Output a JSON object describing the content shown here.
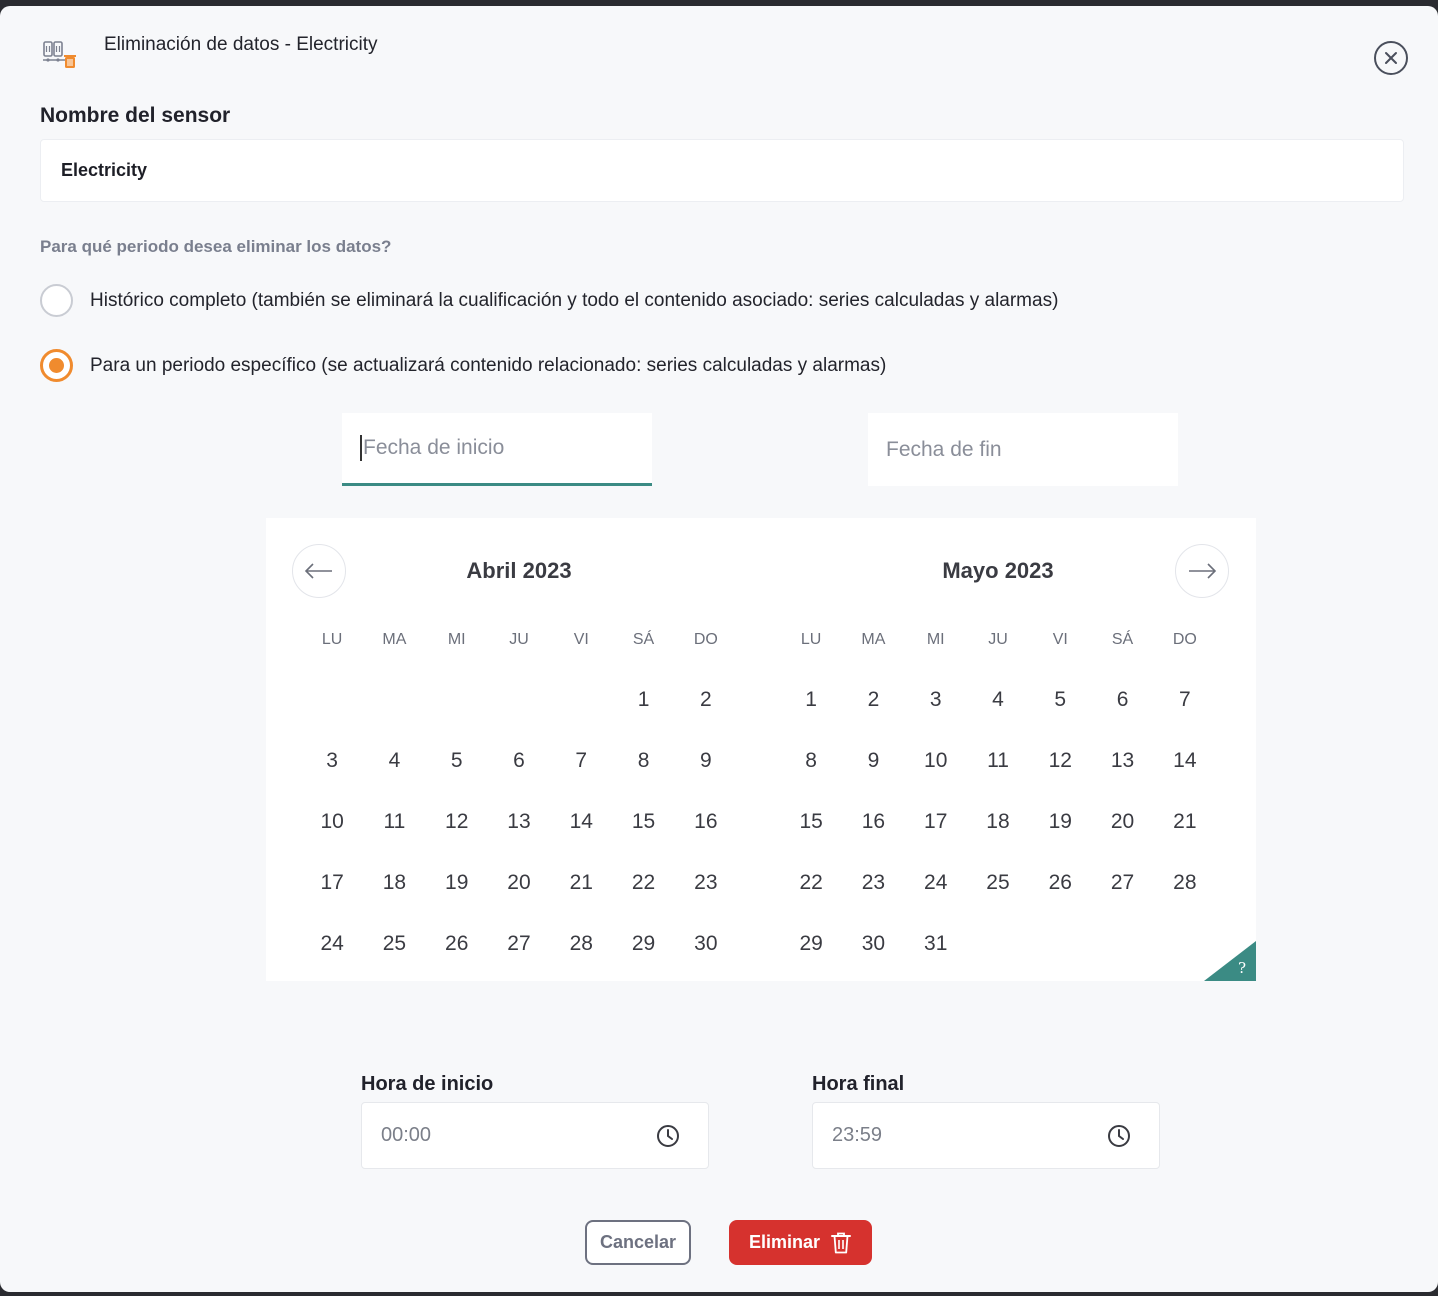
{
  "header": {
    "title": "Eliminación de datos - Electricity",
    "icon": "sensor-delete-icon",
    "close_icon": "close-icon"
  },
  "sensor": {
    "label": "Nombre del sensor",
    "value": "Electricity"
  },
  "period": {
    "question": "Para qué periodo desea eliminar los datos?",
    "options": [
      {
        "label": "Histórico completo (también se eliminará la cualificación y todo el contenido asociado: series calculadas y alarmas)",
        "checked": false
      },
      {
        "label": "Para un periodo específico (se actualizará contenido relacionado: series calculadas y alarmas)",
        "checked": true
      }
    ]
  },
  "dates": {
    "start_placeholder": "Fecha de inicio",
    "end_placeholder": "Fecha de fin"
  },
  "calendar": {
    "weekdays": [
      "LU",
      "MA",
      "MI",
      "JU",
      "VI",
      "SÁ",
      "DO"
    ],
    "months": [
      {
        "title": "Abril 2023",
        "weeks": [
          [
            "",
            "",
            "",
            "",
            "",
            "1",
            "2"
          ],
          [
            "3",
            "4",
            "5",
            "6",
            "7",
            "8",
            "9"
          ],
          [
            "10",
            "11",
            "12",
            "13",
            "14",
            "15",
            "16"
          ],
          [
            "17",
            "18",
            "19",
            "20",
            "21",
            "22",
            "23"
          ],
          [
            "24",
            "25",
            "26",
            "27",
            "28",
            "29",
            "30"
          ]
        ]
      },
      {
        "title": "Mayo 2023",
        "weeks": [
          [
            "1",
            "2",
            "3",
            "4",
            "5",
            "6",
            "7"
          ],
          [
            "8",
            "9",
            "10",
            "11",
            "12",
            "13",
            "14"
          ],
          [
            "15",
            "16",
            "17",
            "18",
            "19",
            "20",
            "21"
          ],
          [
            "22",
            "23",
            "24",
            "25",
            "26",
            "27",
            "28"
          ],
          [
            "29",
            "30",
            "31",
            "",
            "",
            "",
            ""
          ]
        ]
      }
    ],
    "help_symbol": "?",
    "accent": "#3b8b84"
  },
  "time": {
    "start_label": "Hora de inicio",
    "start_value": "00:00",
    "end_label": "Hora final",
    "end_value": "23:59"
  },
  "actions": {
    "cancel_label": "Cancelar",
    "delete_label": "Eliminar"
  },
  "colors": {
    "radio_accent": "#f08b2e",
    "delete_button": "#d6322e",
    "focus_underline": "#3b8b84"
  }
}
